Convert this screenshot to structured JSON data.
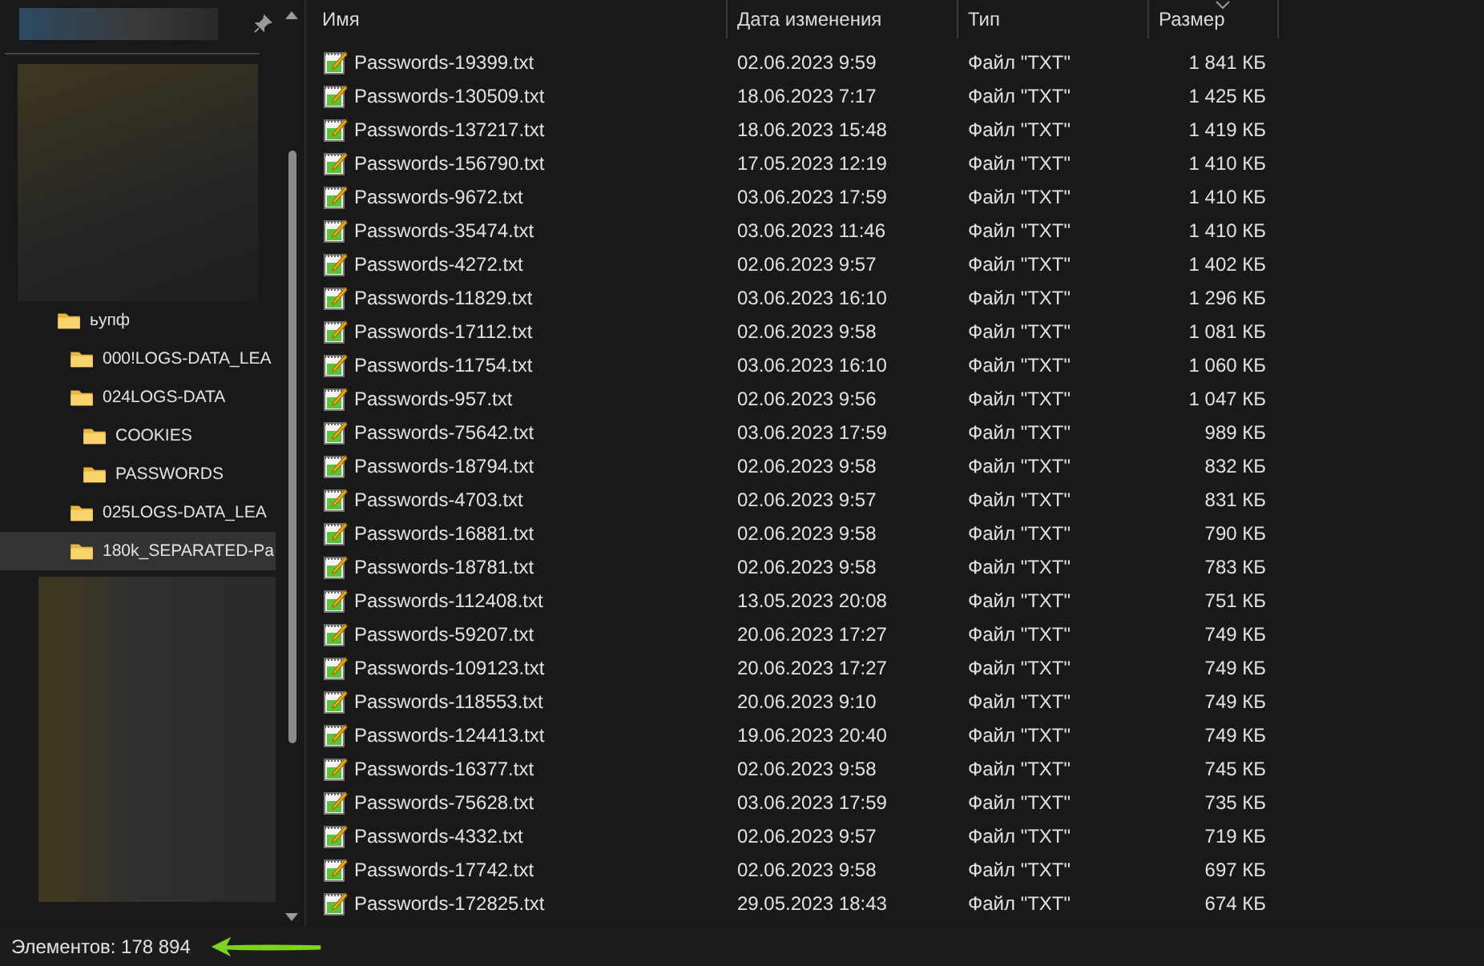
{
  "sidebar": {
    "tree": [
      {
        "label": "ьупф",
        "selected": false,
        "children": [
          {
            "label": "000!LOGS-DATA_LEA",
            "selected": false
          },
          {
            "label": "024LOGS-DATA",
            "selected": false,
            "children": [
              {
                "label": "COOKIES",
                "selected": false
              },
              {
                "label": "PASSWORDS",
                "selected": false
              }
            ]
          },
          {
            "label": "025LOGS-DATA_LEA",
            "selected": false
          },
          {
            "label": "180k_SEPARATED-Pa",
            "selected": true
          }
        ]
      }
    ]
  },
  "table": {
    "columns": [
      "Имя",
      "Дата изменения",
      "Тип",
      "Размер"
    ],
    "rows": [
      {
        "name": "Passwords-19399.txt",
        "date": "02.06.2023 9:59",
        "type": "Файл \"TXT\"",
        "size": "1 841 КБ"
      },
      {
        "name": "Passwords-130509.txt",
        "date": "18.06.2023 7:17",
        "type": "Файл \"TXT\"",
        "size": "1 425 КБ"
      },
      {
        "name": "Passwords-137217.txt",
        "date": "18.06.2023 15:48",
        "type": "Файл \"TXT\"",
        "size": "1 419 КБ"
      },
      {
        "name": "Passwords-156790.txt",
        "date": "17.05.2023 12:19",
        "type": "Файл \"TXT\"",
        "size": "1 410 КБ"
      },
      {
        "name": "Passwords-9672.txt",
        "date": "03.06.2023 17:59",
        "type": "Файл \"TXT\"",
        "size": "1 410 КБ"
      },
      {
        "name": "Passwords-35474.txt",
        "date": "03.06.2023 11:46",
        "type": "Файл \"TXT\"",
        "size": "1 410 КБ"
      },
      {
        "name": "Passwords-4272.txt",
        "date": "02.06.2023 9:57",
        "type": "Файл \"TXT\"",
        "size": "1 402 КБ"
      },
      {
        "name": "Passwords-11829.txt",
        "date": "03.06.2023 16:10",
        "type": "Файл \"TXT\"",
        "size": "1 296 КБ"
      },
      {
        "name": "Passwords-17112.txt",
        "date": "02.06.2023 9:58",
        "type": "Файл \"TXT\"",
        "size": "1 081 КБ"
      },
      {
        "name": "Passwords-11754.txt",
        "date": "03.06.2023 16:10",
        "type": "Файл \"TXT\"",
        "size": "1 060 КБ"
      },
      {
        "name": "Passwords-957.txt",
        "date": "02.06.2023 9:56",
        "type": "Файл \"TXT\"",
        "size": "1 047 КБ"
      },
      {
        "name": "Passwords-75642.txt",
        "date": "03.06.2023 17:59",
        "type": "Файл \"TXT\"",
        "size": "989 КБ"
      },
      {
        "name": "Passwords-18794.txt",
        "date": "02.06.2023 9:58",
        "type": "Файл \"TXT\"",
        "size": "832 КБ"
      },
      {
        "name": "Passwords-4703.txt",
        "date": "02.06.2023 9:57",
        "type": "Файл \"TXT\"",
        "size": "831 КБ"
      },
      {
        "name": "Passwords-16881.txt",
        "date": "02.06.2023 9:58",
        "type": "Файл \"TXT\"",
        "size": "790 КБ"
      },
      {
        "name": "Passwords-18781.txt",
        "date": "02.06.2023 9:58",
        "type": "Файл \"TXT\"",
        "size": "783 КБ"
      },
      {
        "name": "Passwords-112408.txt",
        "date": "13.05.2023 20:08",
        "type": "Файл \"TXT\"",
        "size": "751 КБ"
      },
      {
        "name": "Passwords-59207.txt",
        "date": "20.06.2023 17:27",
        "type": "Файл \"TXT\"",
        "size": "749 КБ"
      },
      {
        "name": "Passwords-109123.txt",
        "date": "20.06.2023 17:27",
        "type": "Файл \"TXT\"",
        "size": "749 КБ"
      },
      {
        "name": "Passwords-118553.txt",
        "date": "20.06.2023 9:10",
        "type": "Файл \"TXT\"",
        "size": "749 КБ"
      },
      {
        "name": "Passwords-124413.txt",
        "date": "19.06.2023 20:40",
        "type": "Файл \"TXT\"",
        "size": "749 КБ"
      },
      {
        "name": "Passwords-16377.txt",
        "date": "02.06.2023 9:58",
        "type": "Файл \"TXT\"",
        "size": "745 КБ"
      },
      {
        "name": "Passwords-75628.txt",
        "date": "03.06.2023 17:59",
        "type": "Файл \"TXT\"",
        "size": "735 КБ"
      },
      {
        "name": "Passwords-4332.txt",
        "date": "02.06.2023 9:57",
        "type": "Файл \"TXT\"",
        "size": "719 КБ"
      },
      {
        "name": "Passwords-17742.txt",
        "date": "02.06.2023 9:58",
        "type": "Файл \"TXT\"",
        "size": "697 КБ"
      },
      {
        "name": "Passwords-172825.txt",
        "date": "29.05.2023 18:43",
        "type": "Файл \"TXT\"",
        "size": "674 КБ"
      }
    ]
  },
  "status_bar": {
    "item_count": "Элементов: 178 894"
  }
}
